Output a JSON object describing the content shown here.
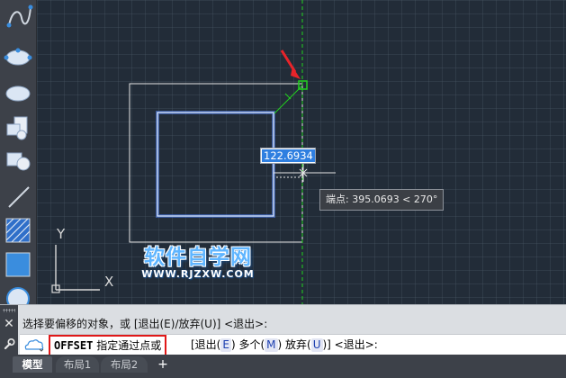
{
  "canvas": {
    "dimension_input_value": "122.6934",
    "tooltip_label": "端点: 395.0693 < 270°",
    "ucs_y_label": "Y",
    "ucs_x_label": "X"
  },
  "watermark": {
    "title": "软件自学网",
    "url": "WWW.RJZXW.COM"
  },
  "command": {
    "history_line": "选择要偏移的对象，或 [退出(E)/放弃(U)] <退出>:",
    "keyword": "OFFSET",
    "prompt": "指定通过点或",
    "options_open": "[退出(",
    "opt_exit_key": "E",
    "options_mid1": ") 多个(",
    "opt_multiple_key": "M",
    "options_mid2": ") 放弃(",
    "opt_undo_key": "U",
    "options_close": ")] <退出>:"
  },
  "tabs": {
    "model": "模型",
    "layout1": "布局1",
    "layout2": "布局2",
    "add": "+"
  },
  "colors": {
    "canvas_bg": "#222c38",
    "selected_rect": "#8fb2ff",
    "offset_rect": "#ffffff",
    "snap_green": "#22d11f",
    "arrow_red": "#e8242a",
    "highlight_box": "#e01818"
  }
}
